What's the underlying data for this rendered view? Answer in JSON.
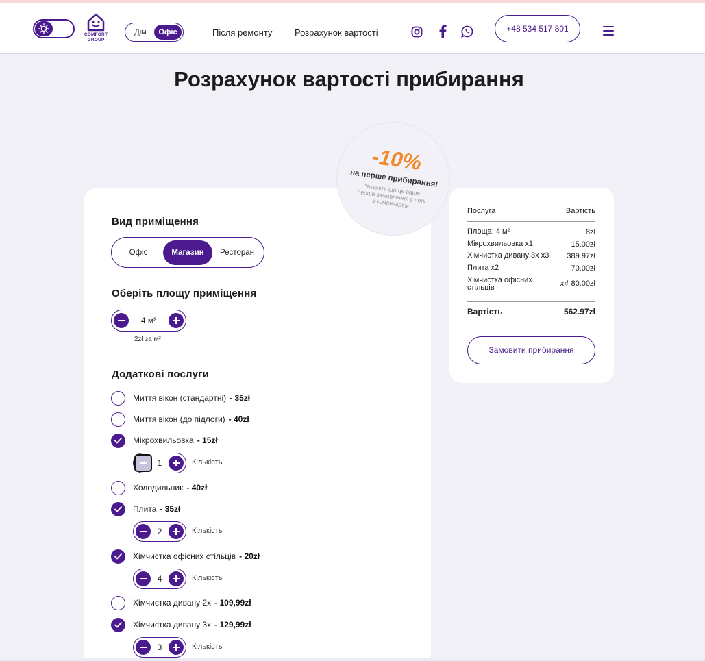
{
  "header": {
    "logo_line1": "COMFORT",
    "logo_line2": "GROUP",
    "mode": {
      "home": "Дім",
      "office": "Офіс"
    },
    "nav": [
      "Після ремонту",
      "Розрахунок вартості"
    ],
    "phone": "+48 534 517 801",
    "icons": [
      "sun-icon",
      "instagram-icon",
      "facebook-icon",
      "whatsapp-icon",
      "menu-icon"
    ]
  },
  "page": {
    "title": "Розрахунок вартості прибирання"
  },
  "promo": {
    "discount": "-10%",
    "subtitle": "на перше прибирання!",
    "note": "*вкажіть що це ваше перше замовлення у полі з коментарем"
  },
  "room_type": {
    "title": "Вид приміщення",
    "options": [
      "Офіс",
      "Магазин",
      "Ресторан"
    ],
    "selected": "Магазин"
  },
  "area": {
    "title": "Оберіть площу приміщення",
    "value": "4 м²",
    "note": "2zł за м²"
  },
  "extras": {
    "title": "Додаткові послуги",
    "quantity_label": "Кількість",
    "items": [
      {
        "name": "Миття вікон (стандартні)",
        "price": "- 35zł",
        "checked": false
      },
      {
        "name": "Миття вікон (до підлоги)",
        "price": "- 40zł",
        "checked": false
      },
      {
        "name": "Мікрохвильовка",
        "price": "- 15zł",
        "checked": true,
        "qty": "1"
      },
      {
        "name": "Холодильник",
        "price": "- 40zł",
        "checked": false
      },
      {
        "name": "Плита",
        "price": "- 35zł",
        "checked": true,
        "qty": "2"
      },
      {
        "name": "Хімчистка офісних стільців",
        "price": "- 20zł",
        "checked": true,
        "qty": "4"
      },
      {
        "name": "Хімчистка дивану 2х",
        "price": "- 109,99zł",
        "checked": false
      },
      {
        "name": "Хімчистка дивану 3х",
        "price": "- 129,99zł",
        "checked": true,
        "qty": "3"
      }
    ]
  },
  "summary": {
    "col_service": "Послуга",
    "col_cost": "Вартість",
    "rows": [
      {
        "name": "Площа: 4 м²",
        "qty": "",
        "cost": "8zł"
      },
      {
        "name": "Мікрохвильовка x1",
        "qty": "",
        "cost": "15.00zł"
      },
      {
        "name": "Хімчистка дивану 3х x3",
        "qty": "",
        "cost": "389.97zł"
      },
      {
        "name": "Плита x2",
        "qty": "",
        "cost": "70.00zł"
      },
      {
        "name": "Хімчистка офісних стільців",
        "qty": "x4",
        "cost": "80.00zł"
      }
    ],
    "total_label": "Вартість",
    "total": "562.97zł",
    "order_button": "Замовити прибирання"
  },
  "colors": {
    "accent": "#4b1a8f",
    "promo": "#f08a2c",
    "background": "#f1f1f7"
  }
}
